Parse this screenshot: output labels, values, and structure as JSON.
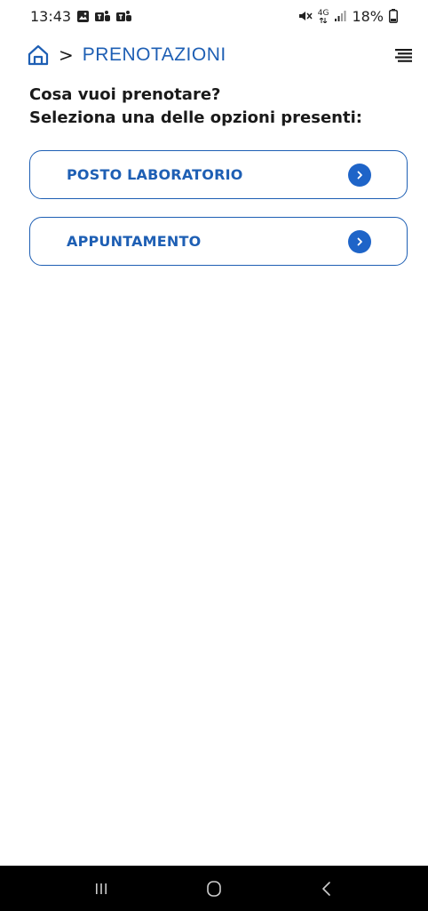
{
  "status_bar": {
    "time": "13:43",
    "battery": "18%",
    "left_icons": [
      "gallery-icon",
      "teams-icon",
      "teams-icon"
    ],
    "right_icons": [
      "mute-icon",
      "4g-icon",
      "signal-icon",
      "battery-icon"
    ],
    "network": "4G"
  },
  "header": {
    "separator": ">",
    "title": "PRENOTAZIONI"
  },
  "prompt": {
    "line1": "Cosa vuoi prenotare?",
    "line2": "Seleziona una delle opzioni presenti:"
  },
  "options": [
    {
      "label": "POSTO LABORATORIO"
    },
    {
      "label": "APPUNTAMENTO"
    }
  ],
  "colors": {
    "accent": "#1e5fb4",
    "chevron_bg": "#1e64c8",
    "nav_bar": "#000000"
  }
}
